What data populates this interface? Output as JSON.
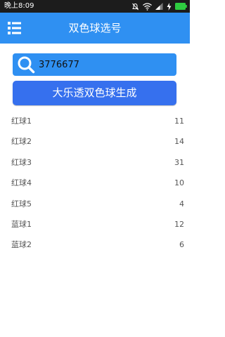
{
  "status_bar": {
    "time": "晚上8:09",
    "icons": [
      "alarm-off-icon",
      "wifi-icon",
      "signal-icon",
      "charging-icon",
      "battery-icon"
    ]
  },
  "app_bar": {
    "title": "双色球选号",
    "menu_icon": "menu-list-icon",
    "background": "#2f90f2"
  },
  "search": {
    "value": "3776677",
    "icon": "search-icon"
  },
  "generate_button": {
    "label": "大乐透双色球生成",
    "color": "#3670ee"
  },
  "results": [
    {
      "label": "红球1",
      "value": "11"
    },
    {
      "label": "红球2",
      "value": "14"
    },
    {
      "label": "红球3",
      "value": "31"
    },
    {
      "label": "红球4",
      "value": "10"
    },
    {
      "label": "红球5",
      "value": "4"
    },
    {
      "label": "蓝球1",
      "value": "12"
    },
    {
      "label": "蓝球2",
      "value": "6"
    }
  ]
}
